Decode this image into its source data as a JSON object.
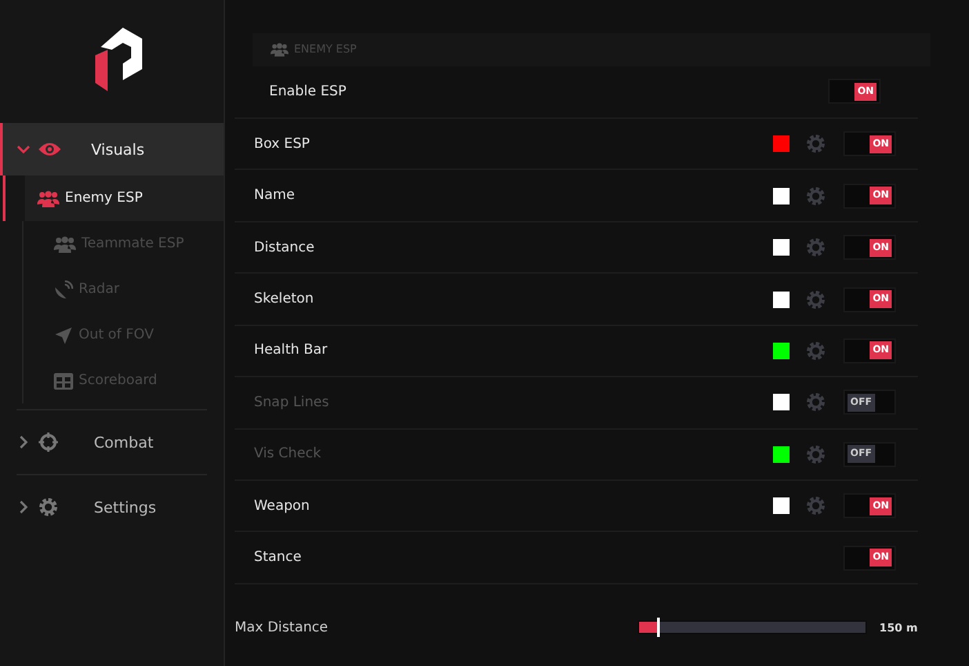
{
  "sidebar": {
    "items": [
      {
        "label": "Visuals",
        "kind": "eye",
        "expanded": true,
        "selected": true,
        "children": [
          {
            "label": "Enemy ESP",
            "kind": "people",
            "selected": true
          },
          {
            "label": "Teammate ESP",
            "kind": "people",
            "selected": false
          },
          {
            "label": "Radar",
            "kind": "radar",
            "selected": false
          },
          {
            "label": "Out of FOV",
            "kind": "arrow",
            "selected": false
          },
          {
            "label": "Scoreboard",
            "kind": "grid",
            "selected": false
          }
        ]
      },
      {
        "label": "Combat",
        "kind": "crosshair",
        "expanded": false,
        "selected": false
      },
      {
        "label": "Settings",
        "kind": "gear",
        "expanded": false,
        "selected": false
      }
    ]
  },
  "section": {
    "title": "ENEMY ESP",
    "enable": {
      "label": "Enable ESP",
      "on": true,
      "toggle_text": "ON"
    }
  },
  "options": [
    {
      "label": "Box ESP",
      "kind": "color",
      "color": "#ff0000",
      "on": true,
      "toggle_text": "ON"
    },
    {
      "label": "Name",
      "kind": "color",
      "color": "#ffffff",
      "on": true,
      "toggle_text": "ON"
    },
    {
      "label": "Distance",
      "kind": "color",
      "color": "#ffffff",
      "on": true,
      "toggle_text": "ON"
    },
    {
      "label": "Skeleton",
      "kind": "color",
      "color": "#ffffff",
      "on": true,
      "toggle_text": "ON"
    },
    {
      "label": "Health Bar",
      "kind": "color",
      "color": "#00ff00",
      "on": true,
      "toggle_text": "ON"
    },
    {
      "label": "Snap Lines",
      "kind": "color",
      "color": "#ffffff",
      "on": false,
      "toggle_text": "OFF"
    },
    {
      "label": "Vis Check",
      "kind": "color",
      "color": "#00ff00",
      "on": false,
      "toggle_text": "OFF"
    },
    {
      "label": "Weapon",
      "kind": "color",
      "color": "#ffffff",
      "on": true,
      "toggle_text": "ON"
    },
    {
      "label": "Stance",
      "kind": "plain",
      "on": true,
      "toggle_text": "ON"
    }
  ],
  "slider": {
    "label": "Max Distance",
    "level": 0.08,
    "reading": "150 m"
  }
}
